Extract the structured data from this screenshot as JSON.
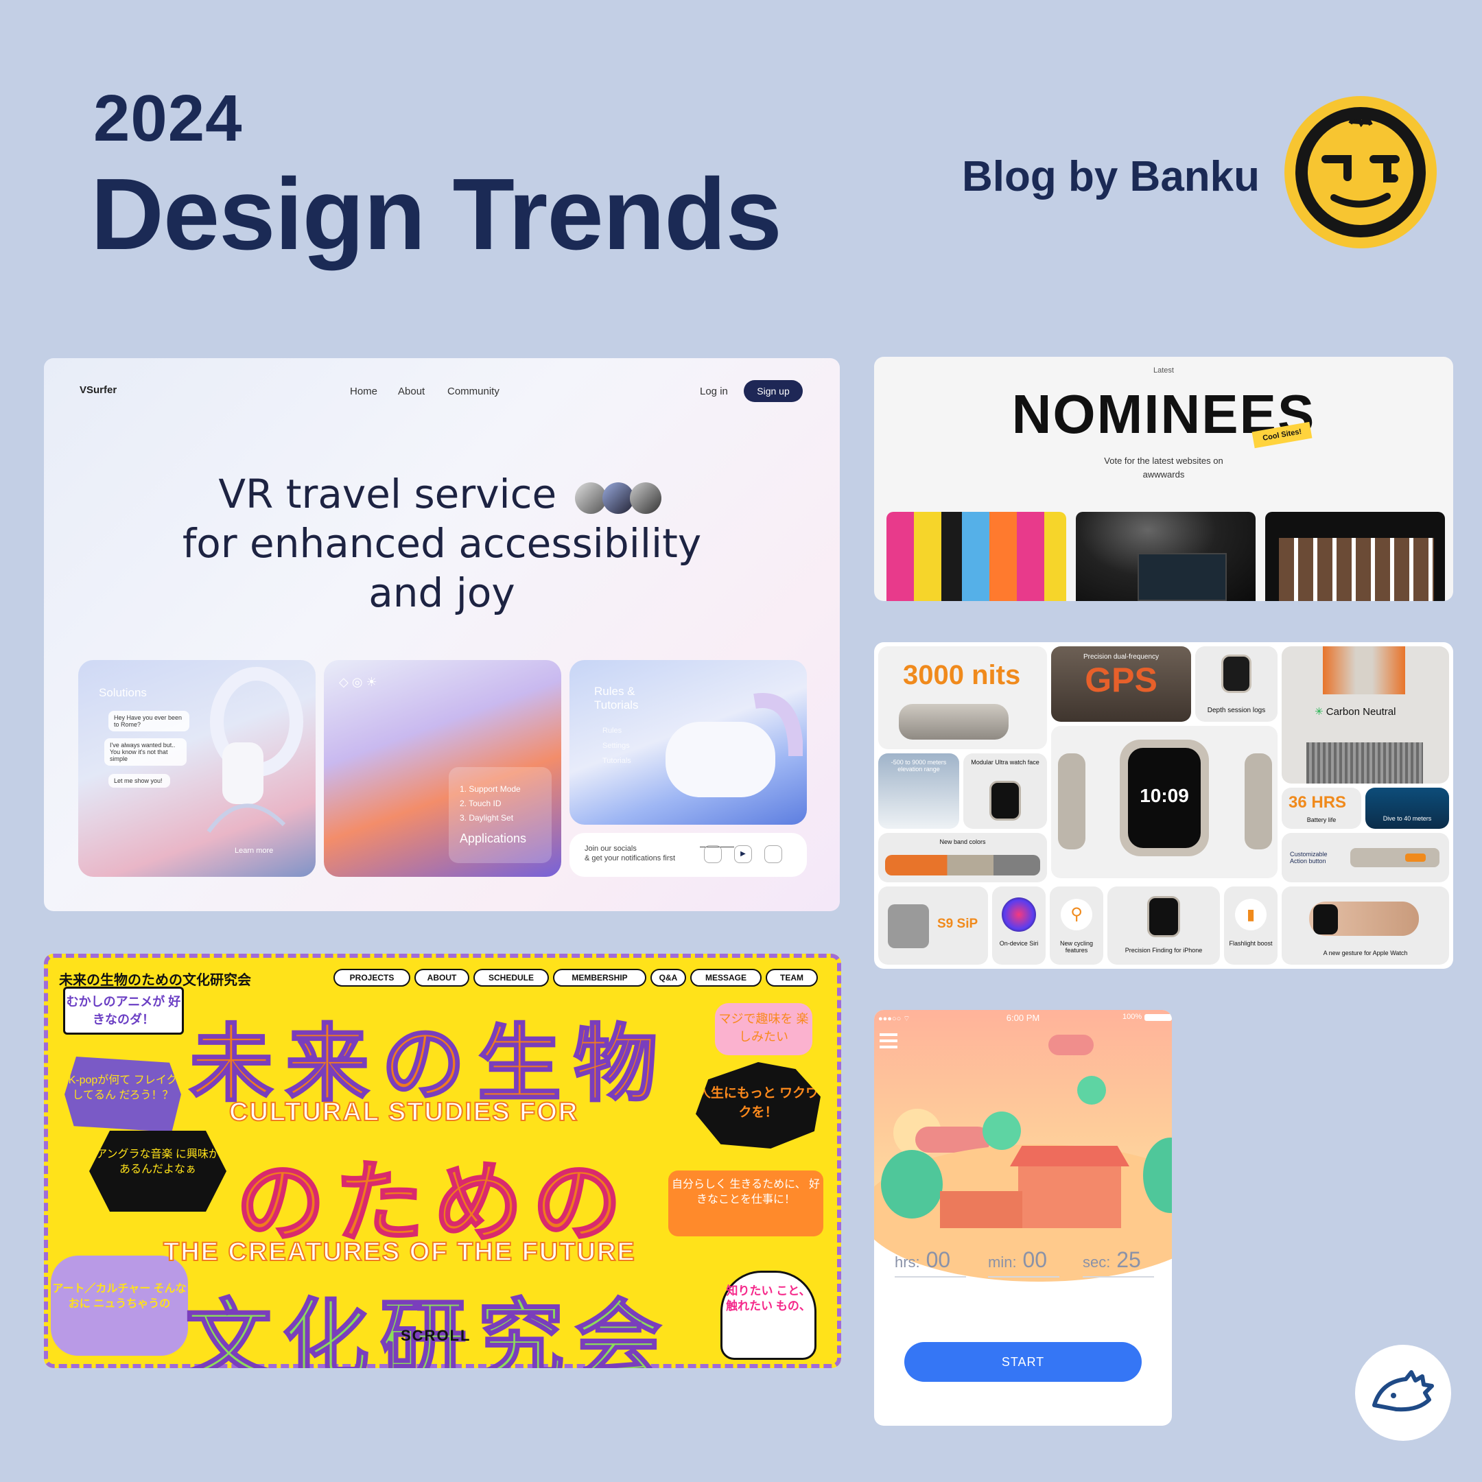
{
  "header": {
    "year": "2024",
    "title": "Design Trends",
    "blog": "Blog by Banku"
  },
  "colors": {
    "background": "#c3cfe5",
    "navy": "#1b2a55",
    "logo_yellow": "#f7c531",
    "start_blue": "#3576f5",
    "jp_yellow": "#ffe21a"
  },
  "icons": [
    "banku-face-logo-icon",
    "hedgehog-logo-icon",
    "instagram-icon",
    "youtube-icon",
    "discord-icon",
    "menu-icon",
    "signal-icon",
    "wifi-icon",
    "battery-icon"
  ],
  "vr": {
    "brand": "VSurfer",
    "nav": [
      "Home",
      "About",
      "Community"
    ],
    "login": "Log in",
    "signup": "Sign up",
    "hero": [
      "VR travel service",
      "for enhanced accessibility",
      "and joy"
    ],
    "panel1": {
      "title": "Solutions",
      "chat": [
        "Hey     Have you ever been to Rome?",
        "I've always wanted but.. You know it's not that simple",
        "Let me show you!"
      ],
      "link": "Learn more"
    },
    "panel2": {
      "list": [
        "1. Support Mode",
        "2. Touch ID",
        "3. Daylight Set"
      ],
      "title": "Applications"
    },
    "panel3": {
      "title": "Rules & Tutorials",
      "items": [
        "Rules",
        "Settings",
        "Tutorials"
      ]
    },
    "socials": {
      "line1": "Join our socials",
      "line2": "& get your notifications first"
    }
  },
  "nominees": {
    "latest": "Latest",
    "title": "NOMINEES",
    "tag": "Cool Sites!",
    "sub1": "Vote for the latest websites on",
    "sub2": "awwwards"
  },
  "watch": {
    "nits": "3000 nits",
    "gps_small": "Precision dual-frequency",
    "gps": "GPS",
    "depth": "Depth session logs",
    "carbon": "Carbon Neutral",
    "elevation": "-500 to 9000 meters elevation range",
    "modular": "Modular Ultra watch face",
    "hrs": "36 HRS",
    "battery": "Battery life",
    "dive": "Dive to 40 meters",
    "bands": "New band colors",
    "custom": "Customizable Action button",
    "time": "10:09",
    "s9": "S9 SiP",
    "siri": "On-device Siri",
    "cycling": "New cycling features",
    "finding": "Precision Finding for iPhone",
    "flash": "Flashlight boost",
    "gesture": "A new gesture for Apple Watch"
  },
  "jp": {
    "site": "未来の生物のための文化研究会",
    "nav": [
      "PROJECTS",
      "ABOUT",
      "SCHEDULE",
      "MEMBERSHIP",
      "Q&A",
      "MESSAGE",
      "TEAM"
    ],
    "bubble1": "むかしのアニメが 好きなのダ！",
    "bubble2": "マジで趣味を 楽しみたい",
    "bubble3": "K-popが何て フレイクしてるん だろう！？",
    "bubble4": "人生にもっと ワクワクを！",
    "bubble5": "アングラな音楽 に興味が あるんだよなぁ",
    "bubble6": "自分らしく 生きるために、 好きなことを仕事に！",
    "bubble7": "アート／カルチャー そんなおに ニュうちゃうの",
    "bubble8": "知りたい こと、 触れたい もの、",
    "row1": "未来の生物",
    "cultural": "CULTURAL STUDIES FOR",
    "row2": "のための",
    "creatures": "THE CREATURES OF THE FUTURE",
    "row3": "文化研究会",
    "scroll": "SCROLL"
  },
  "timer": {
    "status_time": "6:00 PM",
    "battery": "100%",
    "hrs_label": "hrs:",
    "hrs": "00",
    "min_label": "min:",
    "min": "00",
    "sec_label": "sec:",
    "sec": "25",
    "start": "START"
  }
}
